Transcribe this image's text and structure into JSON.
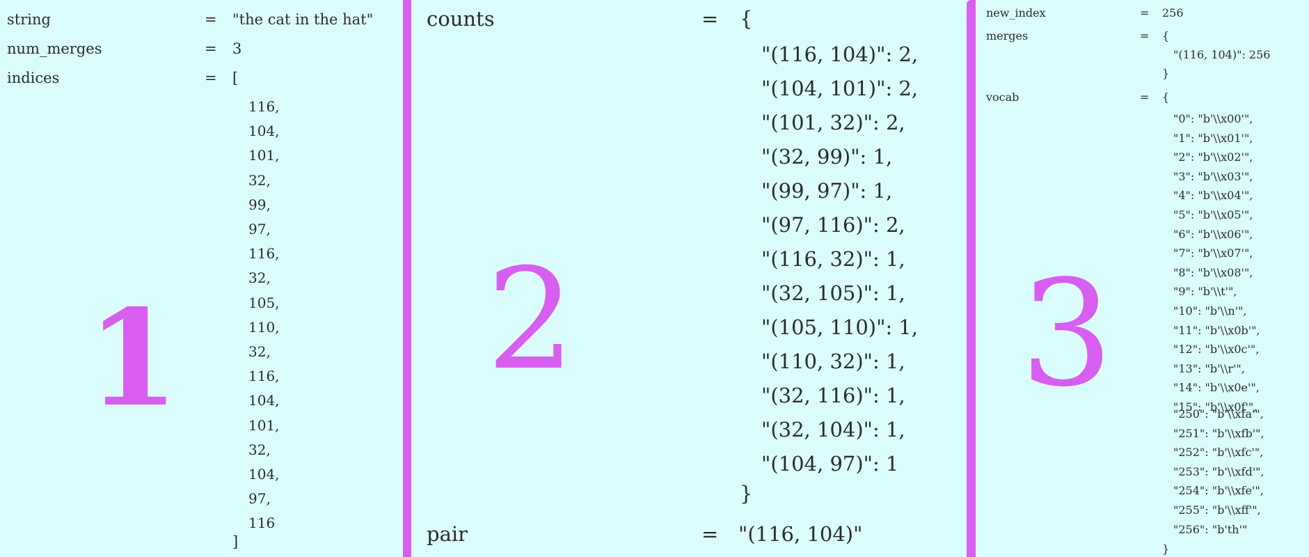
{
  "panel1": {
    "number": "1",
    "string": {
      "name": "string",
      "eq": "=",
      "value": "\"the cat in the hat\""
    },
    "num_merges": {
      "name": "num_merges",
      "eq": "=",
      "value": "3"
    },
    "indices": {
      "name": "indices",
      "eq": "=",
      "open": "[",
      "close": "]",
      "items": [
        "116,",
        "104,",
        "101,",
        "32,",
        "99,",
        "97,",
        "116,",
        "32,",
        "105,",
        "110,",
        "32,",
        "116,",
        "104,",
        "101,",
        "32,",
        "104,",
        "97,",
        "116"
      ]
    }
  },
  "panel2": {
    "number": "2",
    "counts": {
      "name": "counts",
      "eq": "=",
      "open": "{",
      "close": "}",
      "items": [
        "\"(116, 104)\": 2,",
        "\"(104, 101)\": 2,",
        "\"(101, 32)\": 2,",
        "\"(32, 99)\": 1,",
        "\"(99, 97)\": 1,",
        "\"(97, 116)\": 2,",
        "\"(116, 32)\": 1,",
        "\"(32, 105)\": 1,",
        "\"(105, 110)\": 1,",
        "\"(110, 32)\": 1,",
        "\"(32, 116)\": 1,",
        "\"(32, 104)\": 1,",
        "\"(104, 97)\": 1"
      ]
    },
    "pair": {
      "name": "pair",
      "eq": "=",
      "value": "\"(116, 104)\""
    }
  },
  "panel3": {
    "number": "3",
    "new_index": {
      "name": "new_index",
      "eq": "=",
      "value": "256"
    },
    "merges": {
      "name": "merges",
      "eq": "=",
      "open": "{",
      "close": "}",
      "items": [
        "\"(116, 104)\": 256"
      ]
    },
    "vocab": {
      "name": "vocab",
      "eq": "=",
      "open": "{",
      "close": "}",
      "items_top": [
        "\"0\": \"b'\\\\x00'\",",
        "\"1\": \"b'\\\\x01'\",",
        "\"2\": \"b'\\\\x02'\",",
        "\"3\": \"b'\\\\x03'\",",
        "\"4\": \"b'\\\\x04'\",",
        "\"5\": \"b'\\\\x05'\",",
        "\"6\": \"b'\\\\x06'\",",
        "\"7\": \"b'\\\\x07'\",",
        "\"8\": \"b'\\\\x08'\",",
        "\"9\": \"b'\\\\t'\",",
        "\"10\": \"b'\\\\n'\",",
        "\"11\": \"b'\\\\x0b'\",",
        "\"12\": \"b'\\\\x0c'\",",
        "\"13\": \"b'\\\\r'\",",
        "\"14\": \"b'\\\\x0e'\",",
        "\"15\": \"b'\\\\x0f'\","
      ],
      "items_bottom": [
        "\"250\": \"b'\\\\xfa'\",",
        "\"251\": \"b'\\\\xfb'\",",
        "\"252\": \"b'\\\\xfc'\",",
        "\"253\": \"b'\\\\xfd'\",",
        "\"254\": \"b'\\\\xfe'\",",
        "\"255\": \"b'\\\\xff'\",",
        "\"256\": \"b'th'\""
      ]
    }
  }
}
